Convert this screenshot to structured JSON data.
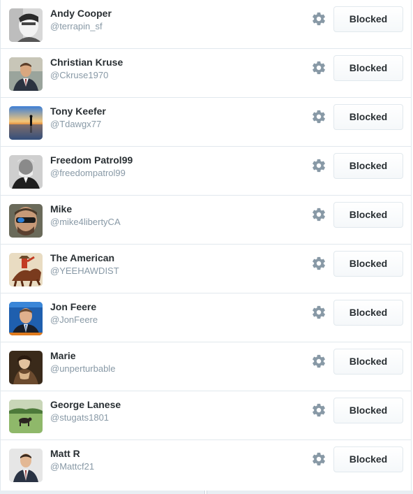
{
  "blocked_accounts": [
    {
      "name": "Andy Cooper",
      "handle": "@terrapin_sf",
      "button_label": "Blocked",
      "avatar_icon": "avatar-bw-portrait"
    },
    {
      "name": "Christian Kruse",
      "handle": "@Ckruse1970",
      "button_label": "Blocked",
      "avatar_icon": "avatar-man-in-suit"
    },
    {
      "name": "Tony Keefer",
      "handle": "@Tdawgx77",
      "button_label": "Blocked",
      "avatar_icon": "avatar-sunset-silhouette"
    },
    {
      "name": "Freedom Patrol99",
      "handle": "@freedompatrol99",
      "button_label": "Blocked",
      "avatar_icon": "avatar-historic-portrait"
    },
    {
      "name": "Mike",
      "handle": "@mike4libertyCA",
      "button_label": "Blocked",
      "avatar_icon": "avatar-man-sunglasses"
    },
    {
      "name": "The American",
      "handle": "@YEEHAWDIST",
      "button_label": "Blocked",
      "avatar_icon": "avatar-cowboy-painting"
    },
    {
      "name": "Jon Feere",
      "handle": "@JonFeere",
      "button_label": "Blocked",
      "avatar_icon": "avatar-tv-interview"
    },
    {
      "name": "Marie",
      "handle": "@unperturbable",
      "button_label": "Blocked",
      "avatar_icon": "avatar-classical-painting"
    },
    {
      "name": "George Lanese",
      "handle": "@stugats1801",
      "button_label": "Blocked",
      "avatar_icon": "avatar-field-animal"
    },
    {
      "name": "Matt R",
      "handle": "@Mattcf21",
      "button_label": "Blocked",
      "avatar_icon": "avatar-man-suit-tie"
    }
  ],
  "colors": {
    "name_text": "#292f33",
    "handle_text": "#8899a6",
    "divider": "#e1e8ed",
    "gear_icon": "#8899a6"
  }
}
